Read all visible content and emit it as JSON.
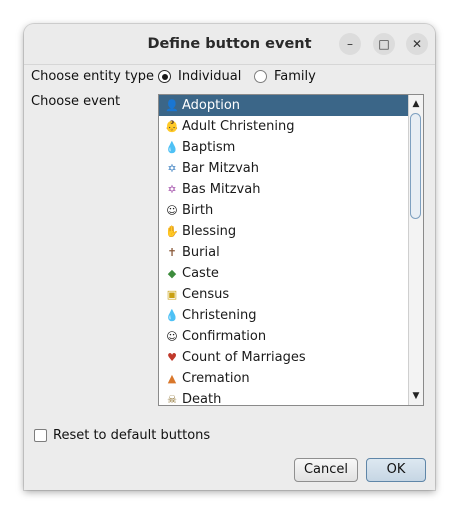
{
  "dialog": {
    "title": "Define button event",
    "controls": {
      "minimize": "–",
      "maximize": "□",
      "close": "✕"
    }
  },
  "entity": {
    "label": "Choose entity type",
    "options": [
      {
        "label": "Individual",
        "selected": true
      },
      {
        "label": "Family",
        "selected": false
      }
    ]
  },
  "event": {
    "label": "Choose event",
    "selected": "Adoption",
    "items": [
      {
        "label": "Adoption",
        "icon": "adoption-icon"
      },
      {
        "label": "Adult Christening",
        "icon": "adult-christening-icon"
      },
      {
        "label": "Baptism",
        "icon": "baptism-icon"
      },
      {
        "label": "Bar Mitzvah",
        "icon": "bar-mitzvah-icon"
      },
      {
        "label": "Bas Mitzvah",
        "icon": "bas-mitzvah-icon"
      },
      {
        "label": "Birth",
        "icon": "birth-icon"
      },
      {
        "label": "Blessing",
        "icon": "blessing-icon"
      },
      {
        "label": "Burial",
        "icon": "burial-icon"
      },
      {
        "label": "Caste",
        "icon": "caste-icon"
      },
      {
        "label": "Census",
        "icon": "census-icon"
      },
      {
        "label": "Christening",
        "icon": "christening-icon"
      },
      {
        "label": "Confirmation",
        "icon": "confirmation-icon"
      },
      {
        "label": "Count of Marriages",
        "icon": "count-of-marriages-icon"
      },
      {
        "label": "Cremation",
        "icon": "cremation-icon"
      },
      {
        "label": "Death",
        "icon": "death-icon"
      }
    ]
  },
  "reset": {
    "label": "Reset to default buttons",
    "checked": false
  },
  "buttons": {
    "cancel": "Cancel",
    "ok": "OK"
  },
  "colors": {
    "selection": "#3b6688",
    "window": "#ececec"
  }
}
